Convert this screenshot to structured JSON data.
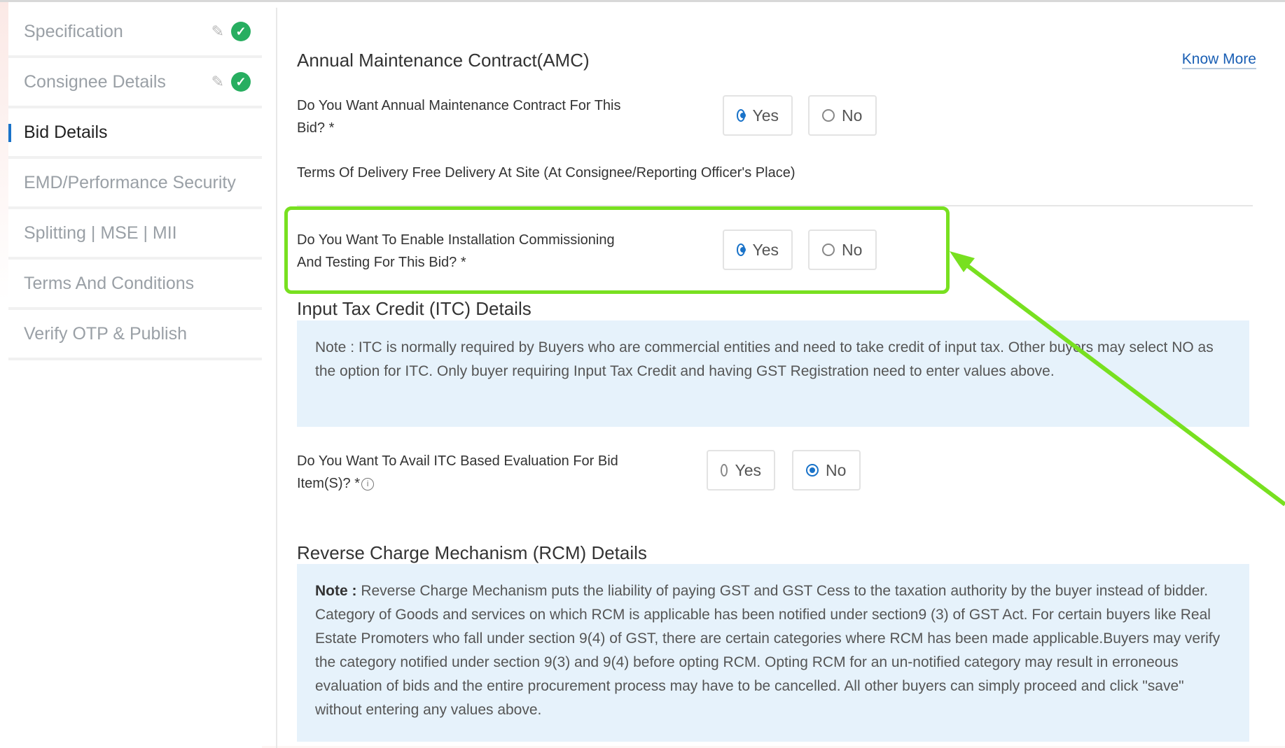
{
  "sidebar": {
    "items": [
      {
        "label": "Specification",
        "done": true
      },
      {
        "label": "Consignee Details",
        "done": true
      },
      {
        "label": "Bid Details",
        "active": true
      },
      {
        "label": "EMD/Performance Security"
      },
      {
        "label": "Splitting | MSE | MII"
      },
      {
        "label": "Terms And Conditions"
      },
      {
        "label": "Verify OTP & Publish"
      }
    ]
  },
  "amc": {
    "title": "Annual Maintenance Contract(AMC)",
    "know_more": "Know More",
    "question_line1": "Do You Want Annual Maintenance Contract For This",
    "question_line2": "Bid? *",
    "yes": "Yes",
    "no": "No",
    "selected": "Yes"
  },
  "delivery": {
    "text": "Terms Of Delivery Free Delivery At Site (At Consignee/Reporting Officer's Place)"
  },
  "installation": {
    "question_line1": "Do You Want To Enable Installation Commissioning",
    "question_line2": "And Testing For This Bid? *",
    "yes": "Yes",
    "no": "No",
    "selected": "Yes"
  },
  "itc": {
    "title": "Input Tax Credit (ITC) Details",
    "note": "Note : ITC is normally required by Buyers who are commercial entities and need to take credit of input tax. Other buyers may select NO as the option for ITC. Only buyer requiring Input Tax Credit and having GST Registration need to enter values above.",
    "question_line1": "Do You Want To Avail ITC Based Evaluation For Bid",
    "question_line2": "Item(S)? *",
    "yes": "Yes",
    "no": "No",
    "selected": "No"
  },
  "rcm": {
    "title": "Reverse Charge Mechanism (RCM) Details",
    "note_label": "Note :",
    "note": " Reverse Charge Mechanism puts the liability of paying GST and GST Cess to the taxation authority by the buyer instead of bidder. Category of Goods and services on which RCM is applicable has been notified under section9 (3) of GST Act. For certain buyers like Real Estate Promoters who fall under section 9(4) of GST, there are certain categories where RCM has been made applicable.Buyers may verify the category notified under section 9(3) and 9(4) before opting RCM. Opting RCM for an un-notified category may result in erroneous evaluation of bids and the entire procurement process may have to be cancelled. All other buyers can simply proceed and click \"save\" without entering any values above."
  },
  "colors": {
    "highlight": "#78e020",
    "accent": "#1a73c9",
    "note_bg": "#e6f2fb",
    "check": "#27ae60"
  }
}
